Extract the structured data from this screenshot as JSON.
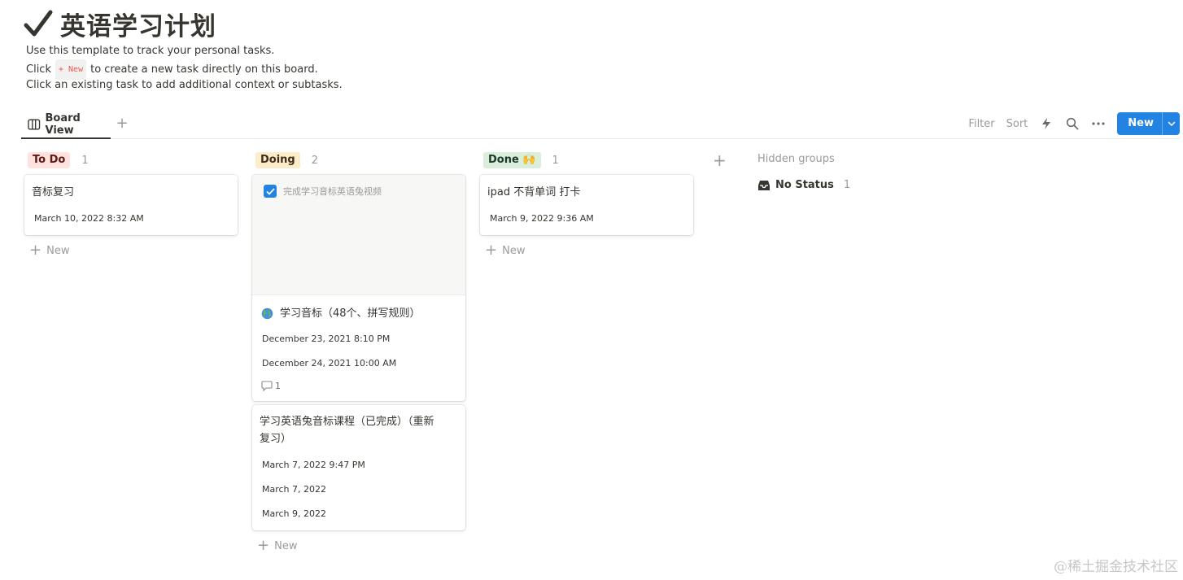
{
  "page": {
    "title": "英语学习计划",
    "desc_line1": "Use this template to track your personal tasks.",
    "desc_line2_prefix": "Click",
    "desc_line2_code": "+ New",
    "desc_line2_suffix": "to create a new task directly on this board.",
    "desc_line3": "Click an existing task to add additional context or subtasks."
  },
  "viewbar": {
    "tab_label": "Board View",
    "add_view": "+",
    "filter": "Filter",
    "sort": "Sort",
    "new_button": "New"
  },
  "columns": {
    "todo": {
      "label": "To Do",
      "count": "1",
      "pill_bg": "#ffe2dd",
      "pill_color": "#5d1715",
      "cards": [
        {
          "title": "音标复习",
          "date": "March 10, 2022 8:32 AM"
        }
      ],
      "add_label": "New"
    },
    "doing": {
      "label": "Doing",
      "count": "2",
      "pill_bg": "#fdecc8",
      "pill_color": "#402c1b",
      "card1": {
        "cover_item": "完成学习音标英语兔视频",
        "title": "学习音标（48个、拼写规则）",
        "date1": "December 23, 2021 8:10 PM",
        "date2": "December 24, 2021 10:00 AM",
        "comments": "1"
      },
      "card2": {
        "title_line1": "学习英语兔音标课程（已完成）（重新",
        "title_line2": "复习）",
        "date1": "March 7, 2022 9:47 PM",
        "date2": "March 7, 2022",
        "date3": "March 9, 2022"
      },
      "add_label": "New"
    },
    "done": {
      "label": "Done 🙌",
      "count": "1",
      "pill_bg": "#dbeddb",
      "pill_color": "#1c3829",
      "cards": [
        {
          "title": "ipad 不背单词 打卡",
          "date": "March 9, 2022 9:36 AM"
        }
      ],
      "add_label": "New"
    }
  },
  "hidden": {
    "label": "Hidden groups",
    "no_status_label": "No Status",
    "no_status_count": "1"
  },
  "watermark": "@稀土掘金技术社区"
}
